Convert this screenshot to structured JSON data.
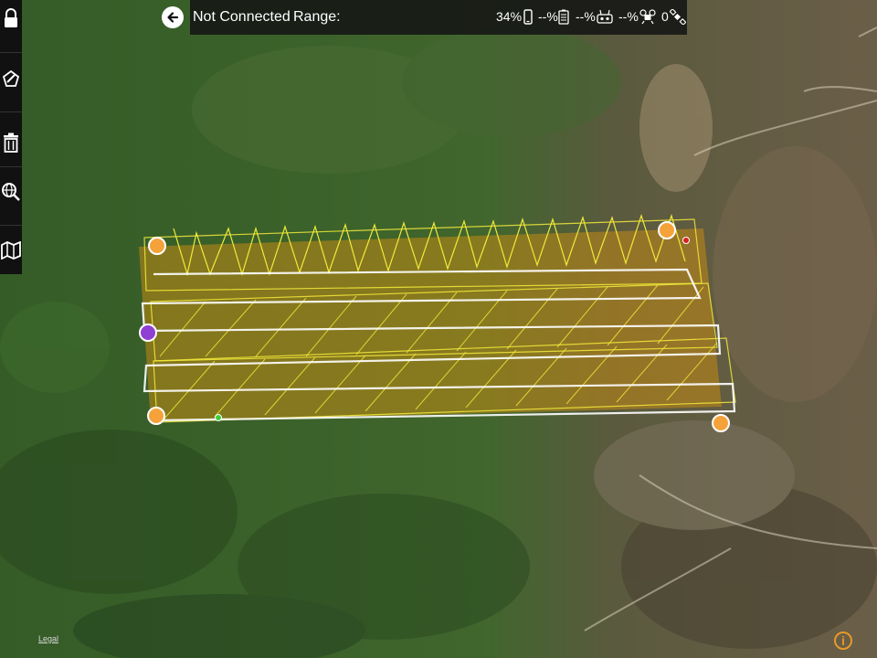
{
  "header": {
    "back_icon": "arrow-left-icon",
    "connection_status": "Not Connected",
    "range_label": "Range:",
    "device_battery": "34%",
    "device_battery_icon": "phone-battery-icon",
    "aircraft_battery": "--%",
    "aircraft_battery_icon": "battery-icon",
    "remote_battery": "--%",
    "remote_battery_icon": "controller-icon",
    "drone_signal": "--%",
    "drone_signal_icon": "drone-icon",
    "gps_count": "0",
    "gps_icon": "satellite-icon"
  },
  "sidebar": {
    "items": [
      {
        "name": "lock",
        "icon": "lock-icon"
      },
      {
        "name": "polygon",
        "icon": "polygon-pen-icon"
      },
      {
        "name": "delete",
        "icon": "trash-icon"
      },
      {
        "name": "search",
        "icon": "globe-search-icon"
      },
      {
        "name": "map",
        "icon": "map-icon"
      }
    ]
  },
  "map": {
    "legal_label": "Legal",
    "info_icon": "info-icon",
    "info_label": "i",
    "colors": {
      "flight_path": "#f2ea3a",
      "coverage_fill": "#c38b14",
      "corner_marker": "#f6a23a",
      "start_marker": "#8f3fd1",
      "home_marker": "#3bd23b",
      "aircraft_marker": "#d82020"
    }
  }
}
